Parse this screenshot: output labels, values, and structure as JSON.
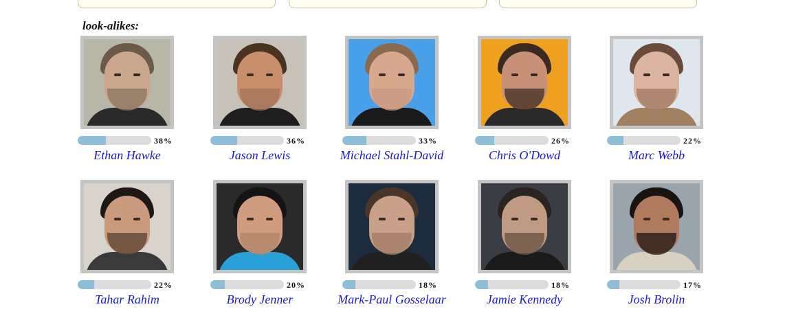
{
  "section_label": "look-alikes:",
  "rows": [
    [
      {
        "name": "Ethan Hawke",
        "percent": "38%",
        "match": 0.38,
        "bg": "#b8b6a8",
        "skin": "#c9a68c",
        "hair": "#6b5a4a",
        "clothes": "#2a2a2a",
        "beard": "#8a7460"
      },
      {
        "name": "Jason Lewis",
        "percent": "36%",
        "match": 0.36,
        "bg": "#c7c2b8",
        "skin": "#c98f6c",
        "hair": "#4a3220",
        "clothes": "#1e1e1e",
        "beard": "#a0735a"
      },
      {
        "name": "Michael Stahl-David",
        "percent": "33%",
        "match": 0.33,
        "bg": "#4aa0e8",
        "skin": "#d8a88e",
        "hair": "#8a6a4e",
        "clothes": "#1a1a1a",
        "beard": "#c89a80"
      },
      {
        "name": "Chris O'Dowd",
        "percent": "26%",
        "match": 0.26,
        "bg": "#f0a020",
        "skin": "#c99078",
        "hair": "#3a2a20",
        "clothes": "#2a2a2a",
        "beard": "#3f2c22"
      },
      {
        "name": "Marc Webb",
        "percent": "22%",
        "match": 0.22,
        "bg": "#dfe6ee",
        "skin": "#dcb4a2",
        "hair": "#6a4a3a",
        "clothes": "#a08060",
        "beard": "#a07a62"
      }
    ],
    [
      {
        "name": "Tahar Rahim",
        "percent": "22%",
        "match": 0.22,
        "bg": "#d8d4cc",
        "skin": "#c99a7e",
        "hair": "#1e1814",
        "clothes": "#3a3a3a",
        "beard": "#5a4030"
      },
      {
        "name": "Brody Jenner",
        "percent": "20%",
        "match": 0.2,
        "bg": "#2a2a2a",
        "skin": "#d09c80",
        "hair": "#141414",
        "clothes": "#2aa0d8",
        "beard": "#b0846a"
      },
      {
        "name": "Mark-Paul Gosselaar",
        "percent": "18%",
        "match": 0.18,
        "bg": "#1c2c3c",
        "skin": "#c9a088",
        "hair": "#4a3628",
        "clothes": "#202020",
        "beard": "#a07c66"
      },
      {
        "name": "Jamie Kennedy",
        "percent": "18%",
        "match": 0.18,
        "bg": "#3a3e44",
        "skin": "#c09a82",
        "hair": "#2a2420",
        "clothes": "#1a1a1a",
        "beard": "#6a5040"
      },
      {
        "name": "Josh Brolin",
        "percent": "17%",
        "match": 0.17,
        "bg": "#9aa4ac",
        "skin": "#b07a5e",
        "hair": "#1a1410",
        "clothes": "#d8d0c0",
        "beard": "#1e1612"
      }
    ]
  ]
}
